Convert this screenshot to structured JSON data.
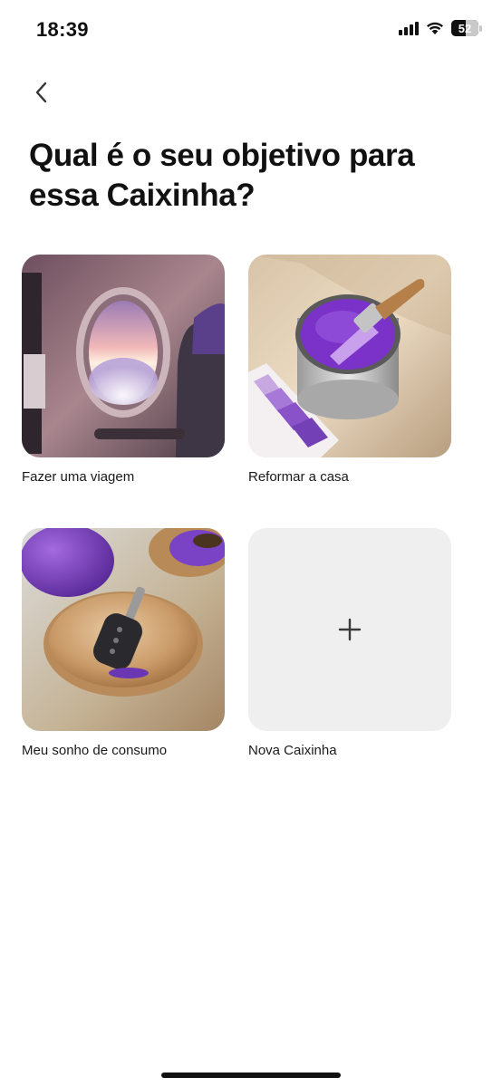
{
  "status_bar": {
    "time": "18:39",
    "battery_level": "52"
  },
  "header": {
    "back_icon": "chevron-left-icon"
  },
  "title": "Qual é o seu objetivo para essa Caixinha?",
  "goals": [
    {
      "label": "Fazer uma viagem",
      "image": "airplane-window-photo"
    },
    {
      "label": "Reformar a casa",
      "image": "paint-can-photo"
    },
    {
      "label": "Meu sonho de consumo",
      "image": "car-key-bowl-photo"
    },
    {
      "label": "Nova Caixinha",
      "image": "plus-icon"
    }
  ],
  "colors": {
    "accent_purple": "#8a3ffc",
    "tile_background": "#efefef",
    "text": "#111111"
  }
}
